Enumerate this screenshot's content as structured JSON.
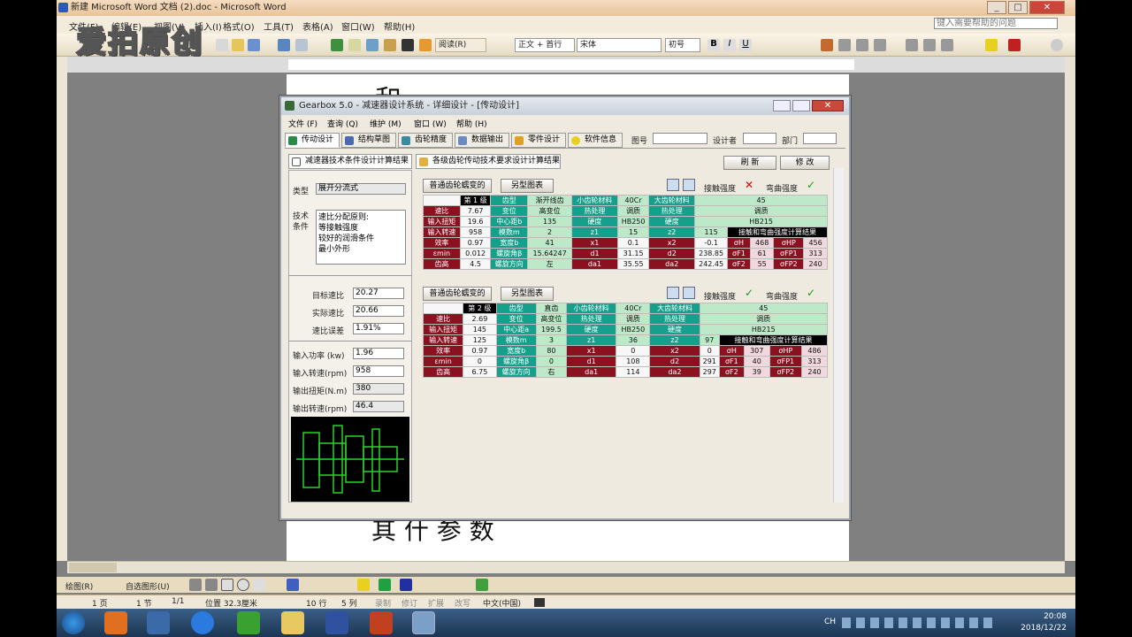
{
  "word": {
    "title": "新建 Microsoft Word 文档 (2).doc - Microsoft Word",
    "menus": [
      "文件(F)",
      "编辑(E)",
      "视图(V)",
      "插入(I)",
      "格式(O)",
      "工具(T)",
      "表格(A)",
      "窗口(W)",
      "帮助(H)"
    ],
    "help_placeholder": "键入需要帮助的问题",
    "view_mode": "阅读(R)",
    "style": "正文 + 首行",
    "font": "宋体",
    "size": "初号",
    "watermark": "爱拍原创",
    "status": {
      "page": "1 页",
      "section": "1 节",
      "pages": "1/1",
      "pos": "位置 32.3厘米",
      "row": "10 行",
      "col": "5 列",
      "rec": "录制",
      "rev": "修订",
      "ext": "扩展",
      "ovr": "改写",
      "lang": "中文(中国)"
    },
    "draw_label": "绘图(R)",
    "autoshape_label": "自选图形(U)",
    "doc_text_top": "和",
    "doc_text_bottom": "其 什 参 数"
  },
  "taskbar": {
    "time": "20:08",
    "date": "2018/12/22",
    "tray": "CH"
  },
  "dialog": {
    "title": "Gearbox 5.0 - 减速器设计系统 - 详细设计 - [传动设计]",
    "menus": [
      "文件 (F)",
      "查询 (Q)",
      "维护 (M)",
      "窗口 (W)",
      "帮助 (H)"
    ],
    "tabs": [
      "传动设计",
      "结构草图",
      "齿轮精度",
      "数据输出",
      "零件设计",
      "软件信息"
    ],
    "tab_fields": {
      "drawing_no": "图号",
      "designer": "设计者",
      "dept": "部门"
    },
    "subtabs": [
      "减速器技术条件设计计算结果",
      "各级齿轮传动技术要求设计计算结果"
    ],
    "buttons": {
      "refresh": "刷 新",
      "modify": "修 改"
    },
    "left": {
      "type_label": "类型",
      "type_value": "展开分流式",
      "tech_label": "技术条件",
      "tech_items": [
        "速比分配原则:",
        "等接触强度",
        "较好的润滑条件",
        "最小外形"
      ],
      "target_ratio_label": "目标速比",
      "target_ratio": "20.27",
      "actual_ratio_label": "实际速比",
      "actual_ratio": "20.66",
      "ratio_err_label": "速比误差",
      "ratio_err": "1.91%",
      "power_label": "输入功率 (kw)",
      "power": "1.96",
      "in_speed_label": "输入转速(rpm)",
      "in_speed": "958",
      "torque_label": "输出扭矩(N.m)",
      "torque": "380",
      "out_speed_label": "输出转速(rpm)",
      "out_speed": "46.4"
    },
    "stage1": {
      "btn_a": "普通齿轮蠕变的",
      "btn_b": "另型图表",
      "bending_label": "接触强度",
      "contact_label": "弯曲强度",
      "rows": [
        [
          "",
          "第 1 级",
          "齿型",
          "渐开线齿",
          "小齿轮材料",
          "40Cr",
          "大齿轮材料",
          "45"
        ],
        [
          "速比",
          "7.67",
          "变位",
          "高变位",
          "热处理",
          "调质",
          "热处理",
          "调质"
        ],
        [
          "输入扭矩",
          "19.6",
          "中心距b",
          "135",
          "硬度",
          "HB250",
          "硬度",
          "HB215"
        ],
        [
          "输入转速",
          "958",
          "模数m",
          "2",
          "z1",
          "15",
          "z2",
          "115"
        ],
        [
          "效率",
          "0.97",
          "宽度b",
          "41",
          "x1",
          "0.1",
          "x2",
          "-0.1"
        ],
        [
          "εmin",
          "0.012",
          "螺旋角β",
          "15.64247",
          "d1",
          "31.15",
          "d2",
          "238.85"
        ],
        [
          "齿高",
          "4.5",
          "螺旋方向",
          "左",
          "da1",
          "35.55",
          "da2",
          "242.45"
        ]
      ],
      "calc_title": "接触和弯曲强度计算结果",
      "calc": [
        [
          "σH",
          "468",
          "σHP",
          "456"
        ],
        [
          "σF1",
          "61",
          "σFP1",
          "313"
        ],
        [
          "σF2",
          "55",
          "σFP2",
          "240"
        ]
      ]
    },
    "stage2": {
      "btn_a": "普通齿轮蠕变的",
      "btn_b": "另型图表",
      "bending_label": "接触强度",
      "contact_label": "弯曲强度",
      "rows": [
        [
          "",
          "第 2 级",
          "齿型",
          "直齿",
          "小齿轮材料",
          "40Cr",
          "大齿轮材料",
          "45"
        ],
        [
          "速比",
          "2.69",
          "变位",
          "高变位",
          "热处理",
          "调质",
          "热处理",
          "调质"
        ],
        [
          "输入扭矩",
          "145",
          "中心距a",
          "199.5",
          "硬度",
          "HB250",
          "硬度",
          "HB215"
        ],
        [
          "输入转速",
          "125",
          "模数m",
          "3",
          "z1",
          "36",
          "z2",
          "97"
        ],
        [
          "效率",
          "0.97",
          "宽度b",
          "80",
          "x1",
          "0",
          "x2",
          "0"
        ],
        [
          "εmin",
          "0",
          "螺旋角β",
          "0",
          "d1",
          "108",
          "d2",
          "291"
        ],
        [
          "齿高",
          "6.75",
          "螺旋方向",
          "右",
          "da1",
          "114",
          "da2",
          "297"
        ]
      ],
      "calc_title": "接触和弯曲强度计算结果",
      "calc": [
        [
          "σH",
          "307",
          "σHP",
          "486"
        ],
        [
          "σF1",
          "40",
          "σFP1",
          "313"
        ],
        [
          "σF2",
          "39",
          "σFP2",
          "240"
        ]
      ]
    }
  }
}
